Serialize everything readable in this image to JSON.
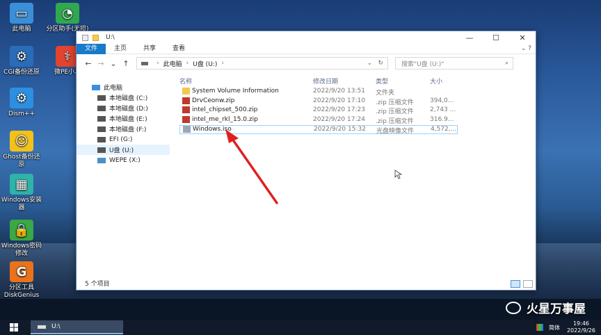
{
  "desktop_icons": [
    {
      "label": "此电脑",
      "icon": "computer-icon",
      "color": "#3b8fd8"
    },
    {
      "label": "分区助手(无损)",
      "icon": "partition-assistant-icon",
      "color": "#2fa84f"
    },
    {
      "label": "CGI备份还原",
      "icon": "cgi-icon",
      "color": "#2b6cb8"
    },
    {
      "label": "微PE小具",
      "icon": "wepe-tools-icon",
      "color": "#e2442f"
    },
    {
      "label": "Dism++",
      "icon": "dism-icon",
      "color": "#2d8fe0"
    },
    {
      "label": "Ghost备份还原",
      "icon": "ghost-icon",
      "color": "#f2c21b"
    },
    {
      "label": "Windows安装器",
      "icon": "windows-installer-icon",
      "color": "#2fb2a8"
    },
    {
      "label": "Windows密码修改",
      "icon": "password-lock-icon",
      "color": "#39a845"
    },
    {
      "label": "分区工具DiskGenius",
      "icon": "diskgenius-icon",
      "color": "#e8731c"
    }
  ],
  "window": {
    "title": "U:\\",
    "controls": {
      "minimize": "—",
      "maximize": "☐",
      "close": "✕"
    },
    "ribbon_tabs": [
      "文件",
      "主页",
      "共享",
      "查看"
    ],
    "nav": {
      "back": "←",
      "forward": "→",
      "recent": "⌄",
      "up": "↑"
    },
    "address": {
      "parts": [
        "此电脑",
        "U盘 (U:)"
      ]
    },
    "search_placeholder": "搜索\"U盘 (U:)\"",
    "sidebar": [
      {
        "label": "此电脑",
        "icon": "computer-icon",
        "indent": 0
      },
      {
        "label": "本地磁盘 (C:)",
        "icon": "drive-icon",
        "indent": 1
      },
      {
        "label": "本地磁盘 (D:)",
        "icon": "drive-icon",
        "indent": 1
      },
      {
        "label": "本地磁盘 (E:)",
        "icon": "drive-icon",
        "indent": 1
      },
      {
        "label": "本地磁盘 (F:)",
        "icon": "drive-icon",
        "indent": 1
      },
      {
        "label": "EFI (G:)",
        "icon": "drive-icon",
        "indent": 1
      },
      {
        "label": "U盘 (U:)",
        "icon": "usb-drive-icon",
        "indent": 1,
        "selected": true
      },
      {
        "label": "WEPE (X:)",
        "icon": "network-drive-icon",
        "indent": 1
      }
    ],
    "columns": [
      "名称",
      "修改日期",
      "类型",
      "大小"
    ],
    "files": [
      {
        "name": "System Volume Information",
        "date": "2022/9/20 13:51",
        "type": "文件夹",
        "size": "",
        "icon": "folder-icon"
      },
      {
        "name": "DrvCeonw.zip",
        "date": "2022/9/20 17:10",
        "type": ".zip 压缩文件",
        "size": "394,0...",
        "icon": "zip-icon"
      },
      {
        "name": "intel_chipset_500.zip",
        "date": "2022/9/20 17:23",
        "type": ".zip 压缩文件",
        "size": "2,743 ...",
        "icon": "zip-icon"
      },
      {
        "name": "intel_me_rkl_15.0.zip",
        "date": "2022/9/20 17:24",
        "type": ".zip 压缩文件",
        "size": "316.9...",
        "icon": "zip-icon"
      },
      {
        "name": "Windows.iso",
        "date": "2022/9/20 15:32",
        "type": "光盘映像文件",
        "size": "4,572,...",
        "icon": "iso-icon",
        "selected": true
      }
    ],
    "status": "5 个项目"
  },
  "taskbar": {
    "start_icon": "windows-start-icon",
    "task_label": "U:\\",
    "ime": "简体",
    "time": "19:46",
    "date": "2022/9/26"
  },
  "watermark": "火星万事屋",
  "colors": {
    "ribbon_file": "#1979ca",
    "arrow": "#e02020"
  }
}
